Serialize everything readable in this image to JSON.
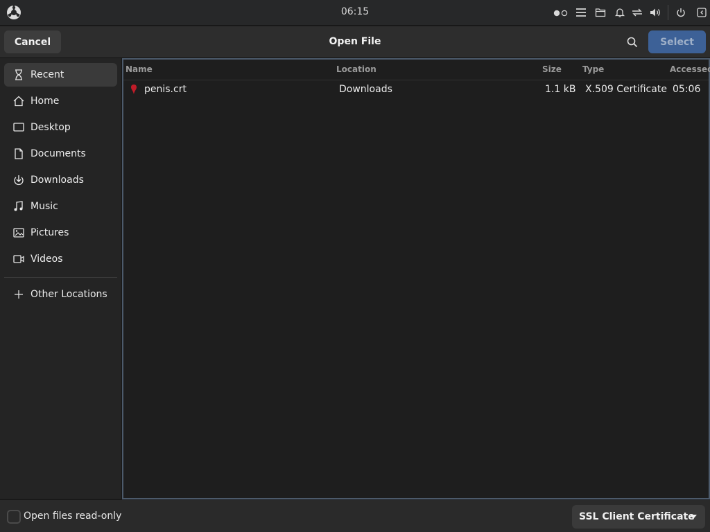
{
  "topbar": {
    "clock": "06:15"
  },
  "header": {
    "cancel_label": "Cancel",
    "title": "Open File",
    "select_label": "Select"
  },
  "sidebar": {
    "items": [
      {
        "label": "Recent",
        "icon": "hourglass-icon",
        "active": true
      },
      {
        "label": "Home",
        "icon": "home-icon"
      },
      {
        "label": "Desktop",
        "icon": "desktop-icon"
      },
      {
        "label": "Documents",
        "icon": "document-icon"
      },
      {
        "label": "Downloads",
        "icon": "download-icon"
      },
      {
        "label": "Music",
        "icon": "music-icon"
      },
      {
        "label": "Pictures",
        "icon": "pictures-icon"
      },
      {
        "label": "Videos",
        "icon": "video-icon"
      }
    ],
    "other_locations": {
      "label": "Other Locations",
      "icon": "plus-icon"
    }
  },
  "filelist": {
    "columns": {
      "name": "Name",
      "location": "Location",
      "size": "Size",
      "type": "Type",
      "accessed": "Accessed"
    },
    "rows": [
      {
        "name": "penis.crt",
        "location": "Downloads",
        "size": "1.1 kB",
        "type": "X.509 Certificate",
        "accessed": "05:06"
      }
    ]
  },
  "bottom": {
    "readonly_label": "Open files read-only",
    "filter_value": "SSL Client Certificate"
  },
  "colors": {
    "accent": "#3d6197",
    "background": "#1e1e1e",
    "sidebar": "#242424",
    "file_icon": "#c01c28"
  }
}
